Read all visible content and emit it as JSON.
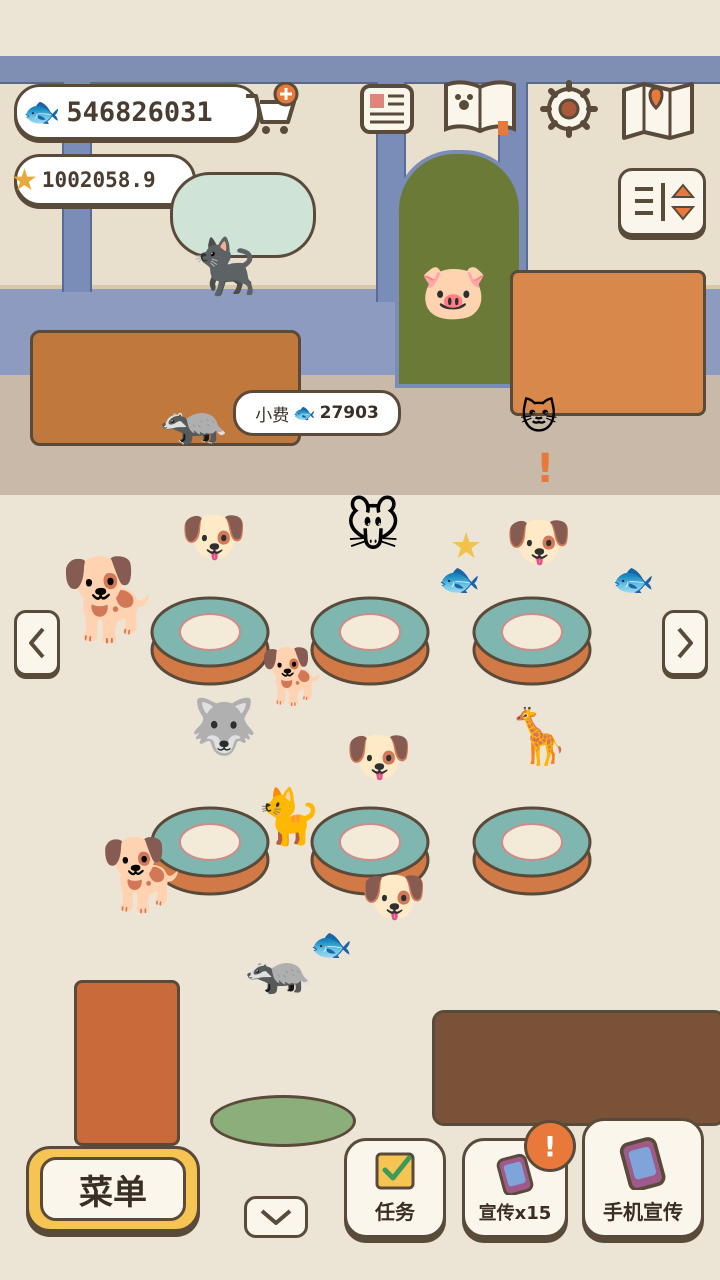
{
  "currency": {
    "fish_count": "546826031",
    "star_count": "1002058.9"
  },
  "tip_bubble": {
    "label": "小费",
    "amount": "27903"
  },
  "top_buttons": [
    "newspaper-icon",
    "album-icon",
    "settings-gear-icon",
    "map-icon",
    "filter-toggle-icon"
  ],
  "bottom_bar": {
    "menu_label": "菜单",
    "task_label": "任务",
    "promo_label": "宣传x15",
    "phone_promo_label": "手机宣传",
    "alert_mark": "!"
  },
  "colors": {
    "outline": "#5a4a3a",
    "menu_button": "#f6c453",
    "table_top": "#7fb7b0",
    "alert_orange": "#e8793a"
  }
}
